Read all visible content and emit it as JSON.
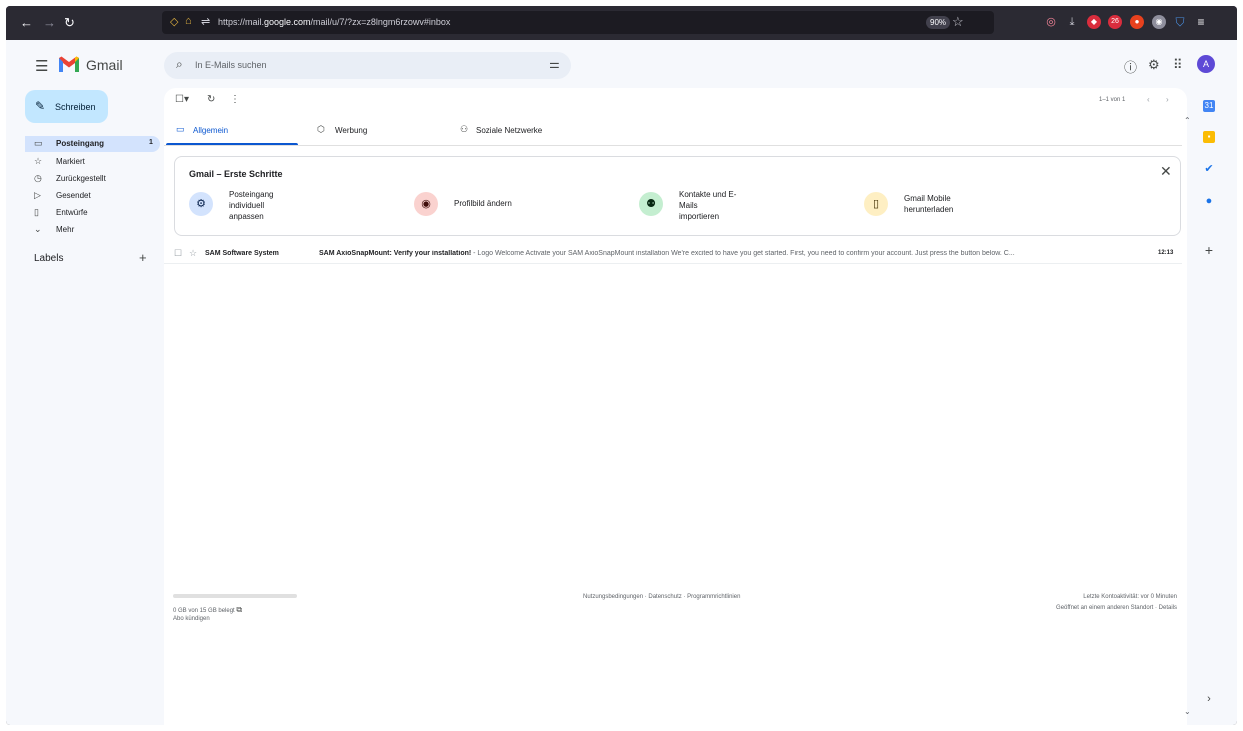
{
  "browser": {
    "url_prefix": "https://mail.",
    "url_domain": "google.com",
    "url_suffix": "/mail/u/7/?zx=z8lngm6rzowv#inbox",
    "zoom": "90%",
    "notif_badge": "26"
  },
  "gmail": {
    "logo_text": "Gmail",
    "search_placeholder": "In E-Mails suchen",
    "avatar_letter": "A",
    "compose_label": "Schreiben",
    "nav": [
      {
        "label": "Posteingang",
        "count": "1",
        "icon": "inbox-icon"
      },
      {
        "label": "Markiert",
        "icon": "star-icon"
      },
      {
        "label": "Zurückgestellt",
        "icon": "clock-icon"
      },
      {
        "label": "Gesendet",
        "icon": "send-icon"
      },
      {
        "label": "Entwürfe",
        "icon": "draft-icon"
      },
      {
        "label": "Mehr",
        "icon": "chevron-down-icon"
      }
    ],
    "labels_title": "Labels",
    "pager": "1–1 von 1",
    "tabs": [
      {
        "label": "Allgemein",
        "icon": "inbox-icon"
      },
      {
        "label": "Werbung",
        "icon": "tag-icon"
      },
      {
        "label": "Soziale Netzwerke",
        "icon": "people-icon"
      }
    ],
    "getting_started": {
      "title": "Gmail – Erste Schritte",
      "steps": [
        {
          "label": "Posteingang individuell anpassen",
          "icon": "gear-icon",
          "color": "#d3e3fd"
        },
        {
          "label": "Profilbild ändern",
          "icon": "account-circle-icon",
          "color": "#fad2cf"
        },
        {
          "label": "Kontakte und E-Mails importieren",
          "icon": "person-add-icon",
          "color": "#c4eed0"
        },
        {
          "label": "Gmail Mobile herunterladen",
          "icon": "phone-icon",
          "color": "#feefc3"
        }
      ]
    },
    "email": {
      "sender": "SAM Software System",
      "subject": "SAM AxioSnapMount: Verify your installation!",
      "snippet": " - Logo Welcome Activate your SAM AxioSnapMount installation We're excited to have you get started. First, you need to confirm your account. Just press the button below. C...",
      "time": "12:13"
    },
    "footer": {
      "storage": "0 GB von 15 GB belegt",
      "cancel": "Abo kündigen",
      "links": "Nutzungsbedingungen · Datenschutz · Programmrichtlinien",
      "activity": "Letzte Kontoaktivität: vor 0 Minuten",
      "opened": "Geöffnet an einem anderen Standort · Details"
    }
  }
}
